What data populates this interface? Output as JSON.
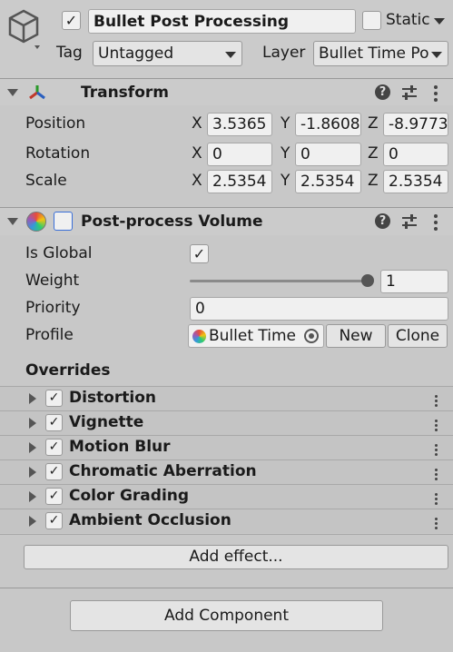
{
  "gameobject": {
    "active_check": "✓",
    "name": "Bullet Post Processing",
    "static_label": "Static",
    "tag_label": "Tag",
    "tag_value": "Untagged",
    "layer_label": "Layer",
    "layer_value": "Bullet Time Po"
  },
  "transform": {
    "title": "Transform",
    "position_label": "Position",
    "rotation_label": "Rotation",
    "scale_label": "Scale",
    "x": "X",
    "y": "Y",
    "z": "Z",
    "position": [
      "3.5365",
      "-1.8608",
      "-8.9773"
    ],
    "rotation": [
      "0",
      "0",
      "0"
    ],
    "scale": [
      "2.5354",
      "2.5354",
      "2.5354"
    ]
  },
  "volume": {
    "title": "Post-process Volume",
    "is_global_label": "Is Global",
    "is_global_check": "✓",
    "weight_label": "Weight",
    "weight_value": "1",
    "weight_fraction": 1.0,
    "priority_label": "Priority",
    "priority_value": "0",
    "profile_label": "Profile",
    "profile_value": "Bullet Time",
    "new_label": "New",
    "clone_label": "Clone",
    "overrides_label": "Overrides",
    "overrides": [
      {
        "name": "Distortion",
        "check": "✓"
      },
      {
        "name": "Vignette",
        "check": "✓"
      },
      {
        "name": "Motion Blur",
        "check": "✓"
      },
      {
        "name": "Chromatic Aberration",
        "check": "✓"
      },
      {
        "name": "Color Grading",
        "check": "✓"
      },
      {
        "name": "Ambient Occlusion",
        "check": "✓"
      }
    ],
    "add_effect_label": "Add effect..."
  },
  "add_component_label": "Add Component",
  "icons": {
    "gameobject": "cube-icon",
    "transform": "transform-axes-icon",
    "volume": "color-wheel-icon",
    "help": "help-icon",
    "presets": "sliders-icon",
    "menu": "kebab-menu-icon",
    "object_picker": "object-picker-icon"
  }
}
